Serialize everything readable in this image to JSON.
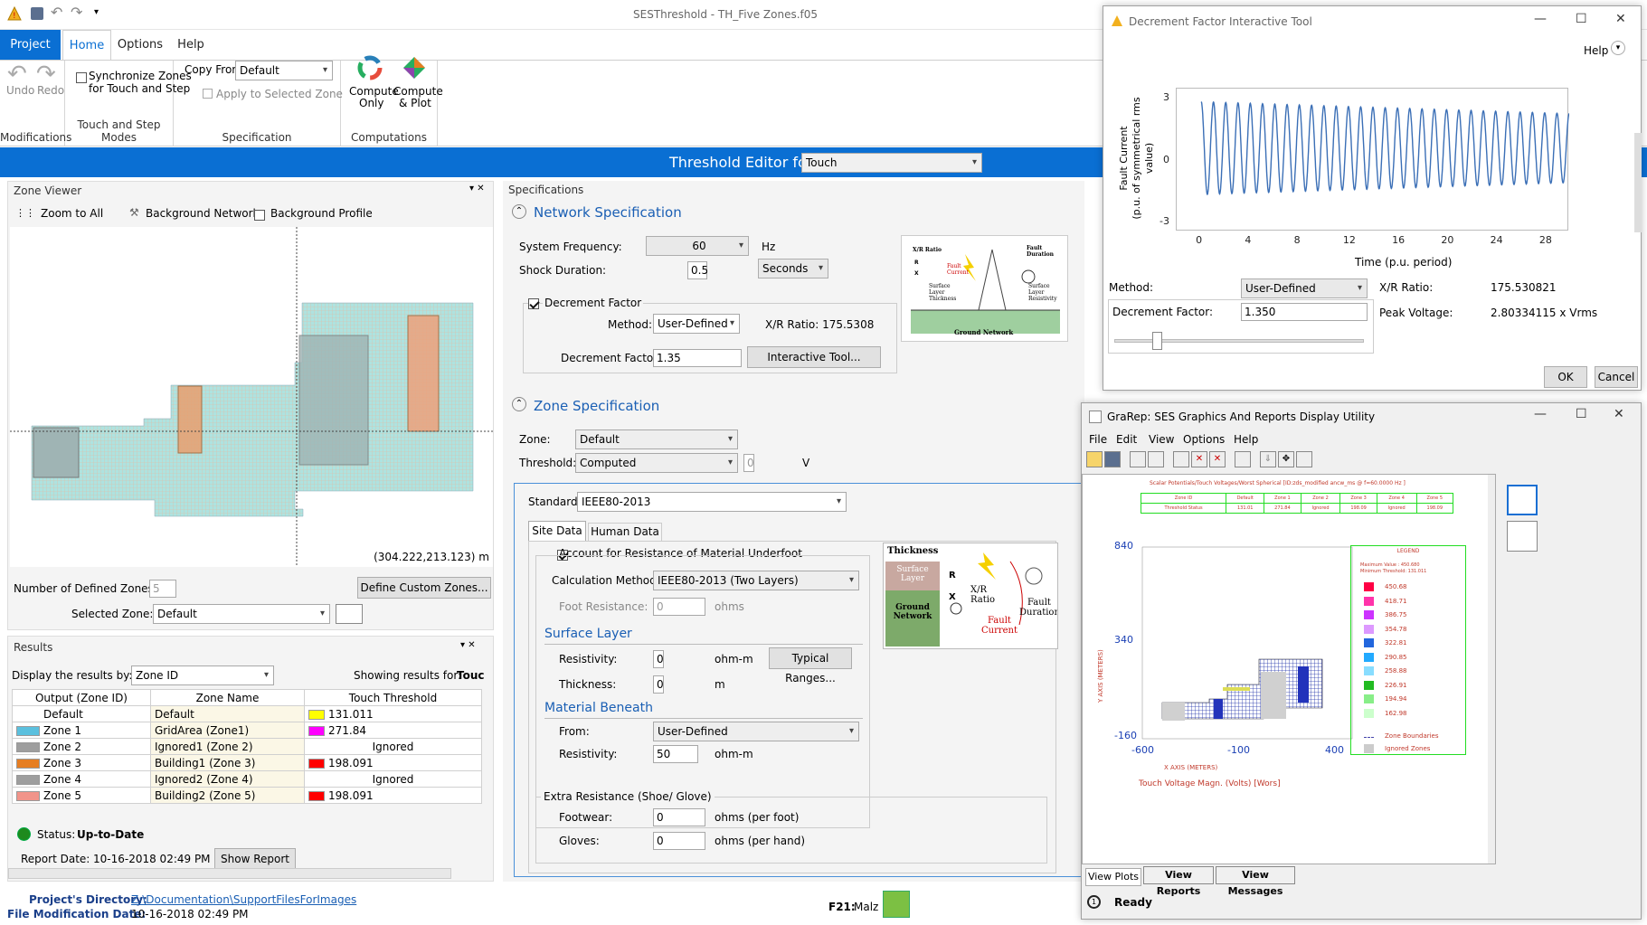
{
  "app": {
    "title": "SESThreshold - TH_Five Zones.f05"
  },
  "ribbon": {
    "tabs": [
      "Project",
      "Home",
      "Options",
      "Help"
    ],
    "undo": "Undo",
    "redo": "Redo",
    "modifications": "Modifications",
    "sync1": "Synchronize Zones",
    "sync2": "for Touch and Step",
    "touch_modes": "Touch and Step Modes",
    "copy_from": "Copy From:",
    "copy_value": "Default",
    "apply": "Apply to Selected Zone",
    "specification": "Specification",
    "compute1": "Compute",
    "compute2": "Only",
    "plot1": "Compute",
    "plot2": "& Plot",
    "computations": "Computations"
  },
  "editor": {
    "label": "Threshold Editor for:",
    "value": "Touch"
  },
  "zone_viewer": {
    "title": "Zone Viewer",
    "zoom": "Zoom to All",
    "bg_network": "Background Network",
    "bg_profile": "Background Profile",
    "coords": "(304.222,213.123) m",
    "num_zones_label": "Number of Defined Zones:",
    "num_zones": "5",
    "define_btn": "Define Custom Zones...",
    "selected_label": "Selected Zone:",
    "selected_value": "Default"
  },
  "results": {
    "title": "Results",
    "display_label": "Display the results by:",
    "display_value": "Zone ID",
    "showing": "Showing results for:",
    "showing_value": "Touc",
    "headers": [
      "Output (Zone ID)",
      "Zone Name",
      "Touch Threshold"
    ],
    "rows": [
      {
        "id": "Default",
        "name": "Default",
        "value": "131.011",
        "color": "#ffff00",
        "idcolor": ""
      },
      {
        "id": "Zone 1",
        "name": "GridArea (Zone1)",
        "value": "271.84",
        "color": "#ff00ff",
        "idcolor": "#5bc0de"
      },
      {
        "id": "Zone 2",
        "name": "Ignored1 (Zone 2)",
        "value": "Ignored",
        "color": "",
        "idcolor": "#9e9e9e"
      },
      {
        "id": "Zone 3",
        "name": "Building1 (Zone 3)",
        "value": "198.091",
        "color": "#ff0000",
        "idcolor": "#e67e22"
      },
      {
        "id": "Zone 4",
        "name": "Ignored2 (Zone 4)",
        "value": "Ignored",
        "color": "",
        "idcolor": "#9e9e9e"
      },
      {
        "id": "Zone 5",
        "name": "Building2 (Zone 5)",
        "value": "198.091",
        "color": "#ff0000",
        "idcolor": "#f1948a"
      }
    ],
    "status_label": "Status:",
    "status_value": "Up-to-Date",
    "report_label": "Report Date:",
    "report_value": "10-16-2018 02:49 PM",
    "show_report": "Show Report"
  },
  "specs": {
    "title": "Specifications",
    "network": "Network Specification",
    "freq_label": "System Frequency:",
    "freq": "60",
    "hz": "Hz",
    "shock_label": "Shock Duration:",
    "shock": "0.5",
    "shock_unit": "Seconds",
    "dec_label": "Decrement Factor",
    "method_label": "Method:",
    "method": "User-Defined",
    "xr": "X/R Ratio:  175.5308",
    "dec_factor_label": "Decrement Factor:",
    "dec_factor": "1.35",
    "interactive": "Interactive Tool...",
    "zone_spec": "Zone Specification",
    "zone_label": "Zone:",
    "zone": "Default",
    "threshold_label": "Threshold:",
    "threshold": "Computed",
    "thr_val": "0",
    "v": "V",
    "standard_label": "Standard:",
    "standard": "IEEE80-2013",
    "tab_site": "Site Data",
    "tab_human": "Human Data",
    "account": "Account for Resistance of Material Underfoot",
    "calc_label": "Calculation Method:",
    "calc": "IEEE80-2013 (Two Layers)",
    "foot_label": "Foot Resistance:",
    "foot": "0",
    "ohms": "ohms",
    "surface": "Surface Layer",
    "res_label": "Resistivity:",
    "res": "0",
    "ohmm": "ohm-m",
    "typical": "Typical Ranges...",
    "thick_label": "Thickness:",
    "thick": "0",
    "m": "m",
    "beneath": "Material Beneath",
    "from_label": "From:",
    "from": "User-Defined",
    "res2": "50",
    "extra": "Extra Resistance (Shoe/ Glove)",
    "foot_wear": "Footwear:",
    "footwear": "0",
    "per_foot": "ohms (per foot)",
    "gloves_label": "Gloves:",
    "gloves": "0",
    "per_hand": "ohms (per hand)"
  },
  "diagram1": {
    "xr": "X/R Ratio",
    "fault_current": "Fault Current",
    "fault_duration": "Fault Duration",
    "surface_thick": "Surface Layer Thickness",
    "surface_res": "Surface Layer Resistivity",
    "ground": "Ground Network",
    "r": "R",
    "x": "X"
  },
  "diagram2": {
    "thickness": "Thickness",
    "surface": "Surface Layer",
    "ground": "Ground Network",
    "r": "R",
    "x": "X",
    "xr": "X/R Ratio",
    "fault_current": "Fault Current",
    "fault_duration": "Fault Duration"
  },
  "footer": {
    "dir_label": "Project's Directory:",
    "dir": "Z:\\Documentation\\SupportFilesForImages",
    "mod_label": "File Modification Date:",
    "mod": "10-16-2018 02:49 PM",
    "f21": "F21:",
    "malz": "Malz"
  },
  "dec_tool": {
    "title": "Decrement Factor Interactive Tool",
    "help": "Help",
    "ylabel1": "Fault Current",
    "ylabel2": "(p.u. of symmetrical rms value)",
    "xlabel": "Time (p.u. period)",
    "yticks": [
      "3",
      "0",
      "-3"
    ],
    "xticks": [
      "0",
      "4",
      "8",
      "12",
      "16",
      "20",
      "24",
      "28"
    ],
    "method_label": "Method:",
    "method": "User-Defined",
    "xr_label": "X/R Ratio:",
    "xr": "175.530821",
    "dec_label": "Decrement Factor:",
    "dec": "1.350",
    "peak_label": "Peak Voltage:",
    "peak": "2.80334115 x Vrms",
    "ok": "OK",
    "cancel": "Cancel",
    "slider_fraction": 0.15
  },
  "grarep": {
    "title": "GraRep: SES Graphics And Reports Display Utility",
    "menu": [
      "File",
      "Edit",
      "View",
      "Options",
      "Help"
    ],
    "plot_title": "Scalar Potentials/Touch Voltages/Worst Spherical [ID:zds_modified ancw_ms @ f=60.0000 Hz ]",
    "table_h": [
      "Zone ID",
      "Default",
      "Zone 1",
      "Zone 2",
      "Zone 3",
      "Zone 4",
      "Zone 5"
    ],
    "table_r": [
      "Threshold Status",
      "131.01",
      "271.84",
      "Ignored",
      "198.09",
      "Ignored",
      "198.09"
    ],
    "yaxis": "Y AXIS (METERS)",
    "xaxis": "X AXIS  (METERS)",
    "caption": "Touch Voltage Magn. (Volts) [Wors]",
    "yticks": [
      "840",
      "340",
      "-160"
    ],
    "xticks": [
      "-600",
      "-100",
      "400"
    ],
    "legend_title": "LEGEND",
    "legend_max": "Maximum Value :   450.680",
    "legend_min": "Minimum Threshold:   131.011",
    "legend": [
      {
        "v": "450.68",
        "c": "#ff0044"
      },
      {
        "v": "418.71",
        "c": "#ff33aa"
      },
      {
        "v": "386.75",
        "c": "#cc33ff"
      },
      {
        "v": "354.78",
        "c": "#dd99ff"
      },
      {
        "v": "322.81",
        "c": "#2266dd"
      },
      {
        "v": "290.85",
        "c": "#22aaff"
      },
      {
        "v": "258.88",
        "c": "#88ddff"
      },
      {
        "v": "226.91",
        "c": "#22bb22"
      },
      {
        "v": "194.94",
        "c": "#88ee88"
      },
      {
        "v": "162.98",
        "c": "#ccffcc"
      }
    ],
    "zone_boundaries": "Zone Boundaries",
    "ignored": "Ignored Zones",
    "tabs": [
      "View Plots",
      "View Reports",
      "View Messages"
    ],
    "status": "Ready"
  },
  "chart_data": {
    "type": "line",
    "title": "",
    "xlabel": "Time (p.u. period)",
    "ylabel": "Fault Current (p.u. of symmetrical rms value)",
    "xlim": [
      -2,
      30
    ],
    "ylim": [
      -3,
      3
    ],
    "series": [
      {
        "amplitude_start": 1.95,
        "amplitude_end": 1.45,
        "offset": 0.5,
        "cycles": 30
      }
    ]
  }
}
